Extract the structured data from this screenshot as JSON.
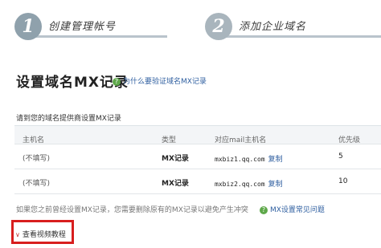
{
  "steps": [
    {
      "number": "1",
      "label": "创建管理帐号"
    },
    {
      "number": "2",
      "label": "添加企业域名"
    }
  ],
  "title": "设置域名MX记录",
  "help_link": "为什么要验证域名MX记录",
  "instruction": "请到您的域名提供商设置MX记录",
  "table": {
    "headers": [
      "主机名",
      "类型",
      "对应mail主机名",
      "优先级"
    ],
    "rows": [
      {
        "host": "(不填写)",
        "type": "MX记录",
        "mail_host": "mxbiz1.qq.com",
        "copy": "复制",
        "priority": "5"
      },
      {
        "host": "(不填写)",
        "type": "MX记录",
        "mail_host": "mxbiz2.qq.com",
        "copy": "复制",
        "priority": "10"
      }
    ]
  },
  "warning": "如果您之前曾经设置MX记录，您需要删除原有的MX记录以避免产生冲突",
  "faq_link": "MX设置常见问题",
  "video_link": "查看视频教程",
  "colors": {
    "link": "#2f5fa0",
    "highlight_border": "#d81e1e",
    "help_icon": "#5ea84a"
  }
}
